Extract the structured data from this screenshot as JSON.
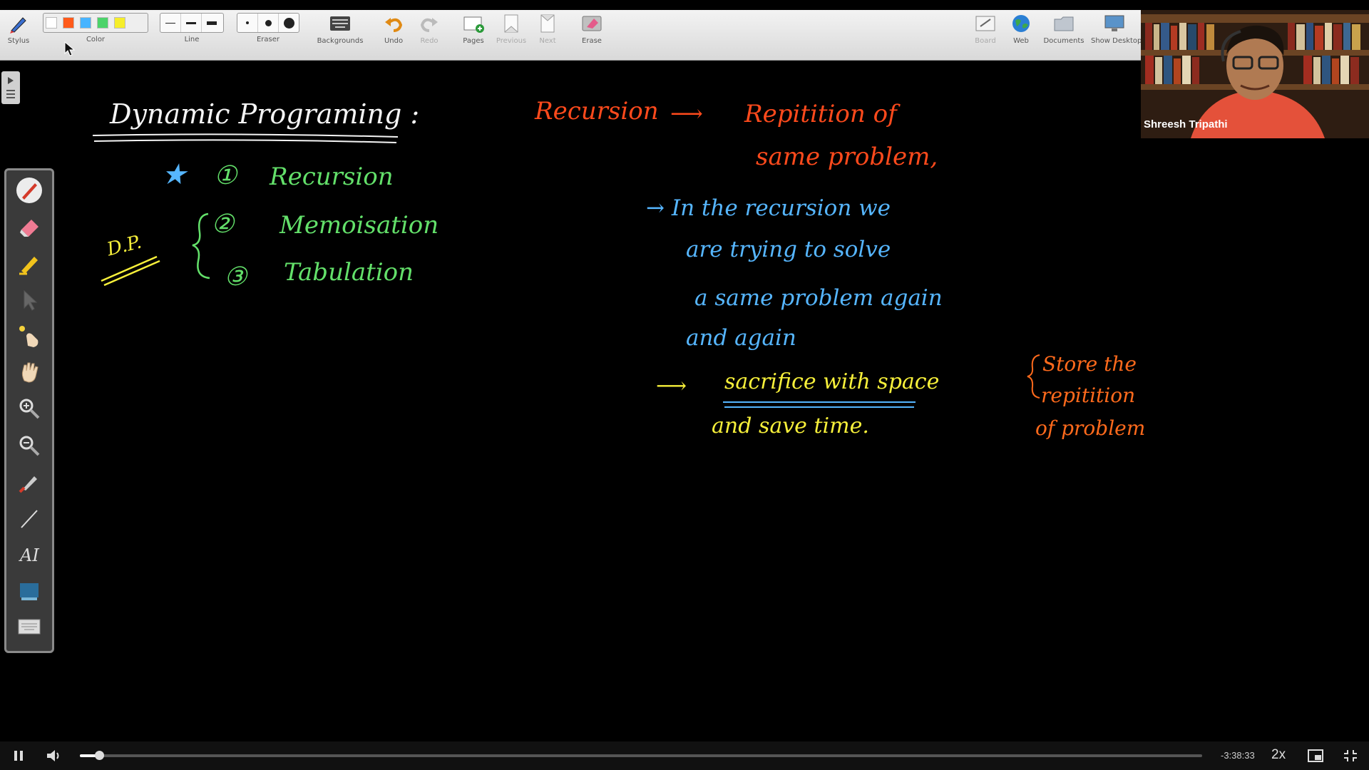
{
  "toolbar": {
    "stylus": "Stylus",
    "color": "Color",
    "line": "Line",
    "eraser": "Eraser",
    "backgrounds": "Backgrounds",
    "undo": "Undo",
    "redo": "Redo",
    "pages": "Pages",
    "previous": "Previous",
    "next": "Next",
    "erase": "Erase",
    "board": "Board",
    "web": "Web",
    "documents": "Documents",
    "show_desktop": "Show Desktop",
    "swatch_colors": [
      "#ffffff",
      "#ff5a1a",
      "#48b4ff",
      "#4cd36a",
      "#f6ee2a"
    ]
  },
  "webcam": {
    "name": "Shreesh Tripathi"
  },
  "board": {
    "title": "Dynamic Programing :",
    "star": "★",
    "dp_label": "D.P.",
    "items": [
      {
        "num": "①",
        "text": "Recursion"
      },
      {
        "num": "②",
        "text": "Memoisation"
      },
      {
        "num": "③",
        "text": "Tabulation"
      }
    ],
    "recursion_title": "Recursion",
    "arrow": "⟶",
    "repetition_line1": "Repitition of",
    "repetition_line2": "same problem,",
    "blue_lines": [
      "→ In the recursion we",
      "are trying to solve",
      "a same problem again",
      "and again"
    ],
    "yellow_line1_arrow": "⟶",
    "yellow_line1": "sacrifice with space",
    "yellow_line2": "and save time.",
    "orange_lines": [
      "Store the",
      "repitition",
      "of problem"
    ]
  },
  "player": {
    "time_remaining": "-3:38:33",
    "speed": "2x",
    "progress_fraction": 0.017
  }
}
